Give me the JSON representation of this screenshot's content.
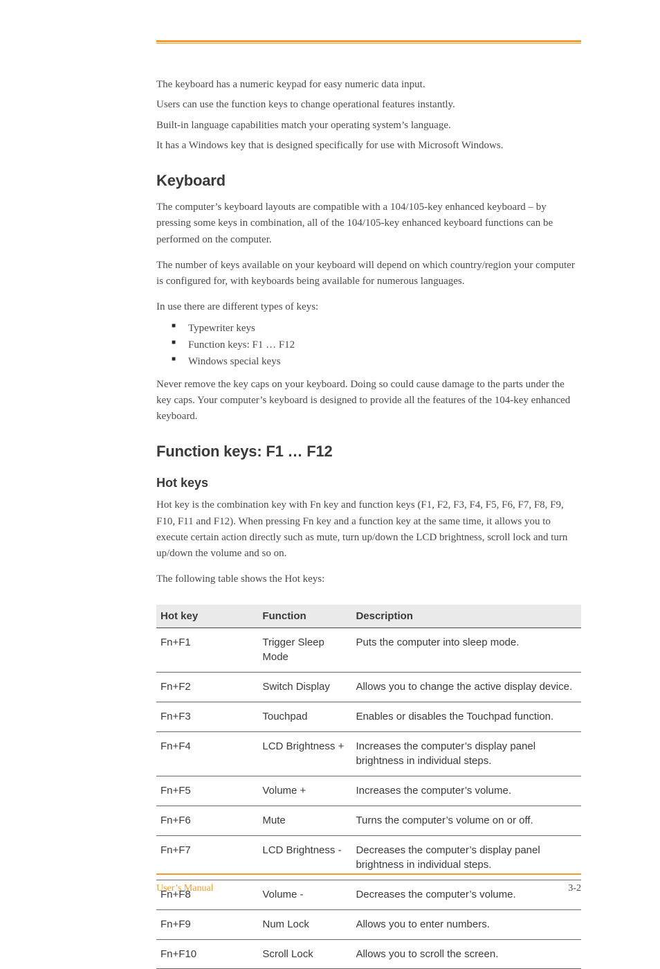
{
  "intro": {
    "p1": "The keyboard has a numeric keypad for easy numeric data input.",
    "p2": "Users can use the function keys to change operational features instantly.",
    "p3": "Built-in language capabilities match your operating system’s language.",
    "p4": "It has a Windows key that is designed specifically for use with Microsoft Windows."
  },
  "section1": {
    "title": "Keyboard",
    "p1": "The computer’s keyboard layouts are compatible with a 104/105-key enhanced keyboard – by pressing some keys in combination, all of the 104/105-key enhanced keyboard functions can be performed on the computer.",
    "p2": "The number of keys available on your keyboard will depend on which country/region your computer is configured for, with keyboards being available for numerous languages.",
    "p3": "In use there are different types of keys:",
    "bullets": [
      "Typewriter keys",
      "Function keys: F1 … F12",
      "Windows special keys"
    ],
    "p4": "Never remove the key caps on your keyboard. Doing so could cause damage to the parts under the key caps. Your computer’s keyboard is designed to provide all the features of the 104-key enhanced keyboard."
  },
  "section2": {
    "title": "Function keys: F1 … F12",
    "sub_title": "Hot keys",
    "p1": "Hot key is the combination key with Fn key and function keys (F1, F2, F3, F4, F5, F6, F7, F8, F9, F10, F11 and F12). When pressing Fn key and a function key at the same time, it allows you to execute certain action directly such as mute, turn up/down the LCD brightness, scroll lock and turn up/down the volume and so on.",
    "p2": "The following table shows the Hot keys:"
  },
  "table": {
    "headers": [
      "Hot key",
      "Function",
      "Description"
    ],
    "rows": [
      [
        "Fn+F1",
        "Trigger Sleep Mode",
        "Puts the computer into sleep mode."
      ],
      [
        "Fn+F2",
        "Switch Display",
        "Allows you to change the active display device."
      ],
      [
        "Fn+F3",
        "Touchpad",
        "Enables or disables the Touchpad function."
      ],
      [
        "Fn+F4",
        "LCD Brightness +",
        "Increases the computer’s display panel brightness in individual steps."
      ],
      [
        "Fn+F5",
        "Volume +",
        "Increases the computer’s volume."
      ],
      [
        "Fn+F6",
        "Mute",
        "Turns the computer’s volume on or off."
      ],
      [
        "Fn+F7",
        "LCD Brightness -",
        "Decreases the computer’s display panel brightness in individual steps."
      ],
      [
        "Fn+F8",
        "Volume -",
        "Decreases the computer’s volume."
      ],
      [
        "Fn+F9",
        "Num Lock",
        "Allows you to enter numbers."
      ],
      [
        "Fn+F10",
        "Scroll Lock",
        "Allows you to scroll the screen."
      ]
    ]
  },
  "footer": {
    "label": "User’s Manual",
    "page": "3-2"
  }
}
